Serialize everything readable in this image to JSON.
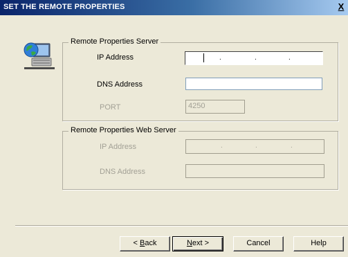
{
  "window": {
    "title": "SET THE REMOTE PROPERTIES",
    "close_glyph": "X"
  },
  "icon": {
    "name": "networked-computer-icon"
  },
  "remote_properties_server": {
    "group_title": "Remote  Properties Server",
    "ip_label": "IP Address",
    "dns_label": "DNS Address",
    "port_label": "PORT",
    "ip_value": "",
    "dns_value": "",
    "port_value": "4250"
  },
  "remote_properties_web_server": {
    "group_title": "Remote Properties Web Server",
    "ip_label": "IP Address",
    "dns_label": "DNS Address",
    "ip_value": "",
    "dns_value": ""
  },
  "buttons": {
    "back_prefix": "< ",
    "back_mnemonic": "B",
    "back_rest": "ack",
    "next_mnemonic": "N",
    "next_rest": "ext >",
    "cancel": "Cancel",
    "help": "Help"
  },
  "colors": {
    "dialog_background": "#ece9d8",
    "titlebar_start": "#0a246a",
    "titlebar_end": "#a6caf0",
    "disabled_text": "#a2a095"
  }
}
